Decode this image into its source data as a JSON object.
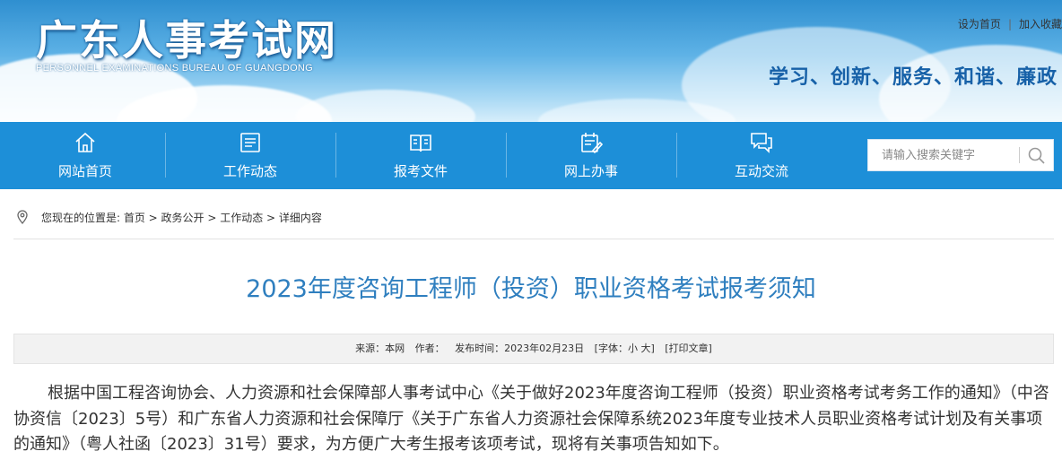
{
  "header": {
    "logo_cn": "广东人事考试网",
    "logo_en": "PERSONNEL EXAMINATIONS BUREAU OF GUANGDONG",
    "links": [
      "设为首页",
      "加入收藏"
    ],
    "slogan": "学习、创新、服务、和谐、廉政"
  },
  "nav": {
    "items": [
      {
        "label": "网站首页",
        "icon": "home-icon"
      },
      {
        "label": "工作动态",
        "icon": "news-list-icon"
      },
      {
        "label": "报考文件",
        "icon": "book-icon"
      },
      {
        "label": "网上办事",
        "icon": "calendar-edit-icon"
      },
      {
        "label": "互动交流",
        "icon": "chat-icon"
      }
    ],
    "search_placeholder": "请输入搜索关键字"
  },
  "breadcrumb": {
    "text": "您现在的位置是:  首页 > 政务公开 > 工作动态 > 详细内容"
  },
  "article": {
    "title": "2023年度咨询工程师（投资）职业资格考试报考须知",
    "meta": {
      "source": "来源：本网",
      "author": "作者：",
      "date": "发布时间：2023年02月23日",
      "font_size": "[字体：小 大]",
      "print": "[打印文章]"
    },
    "body": "根据中国工程咨询协会、人力资源和社会保障部人事考试中心《关于做好2023年度咨询工程师（投资）职业资格考试考务工作的通知》（中咨协资信〔2023〕5号）和广东省人力资源和社会保障厅《关于广东省人力资源社会保障系统2023年度专业技术人员职业资格考试计划及有关事项的通知》（粤人社函〔2023〕31号）要求，为方便广大考生报考该项考试，现将有关事项告知如下。"
  },
  "colors": {
    "nav_bg": "#1d8fd8",
    "title": "#2f7fbf",
    "slogan": "#1761a8"
  }
}
